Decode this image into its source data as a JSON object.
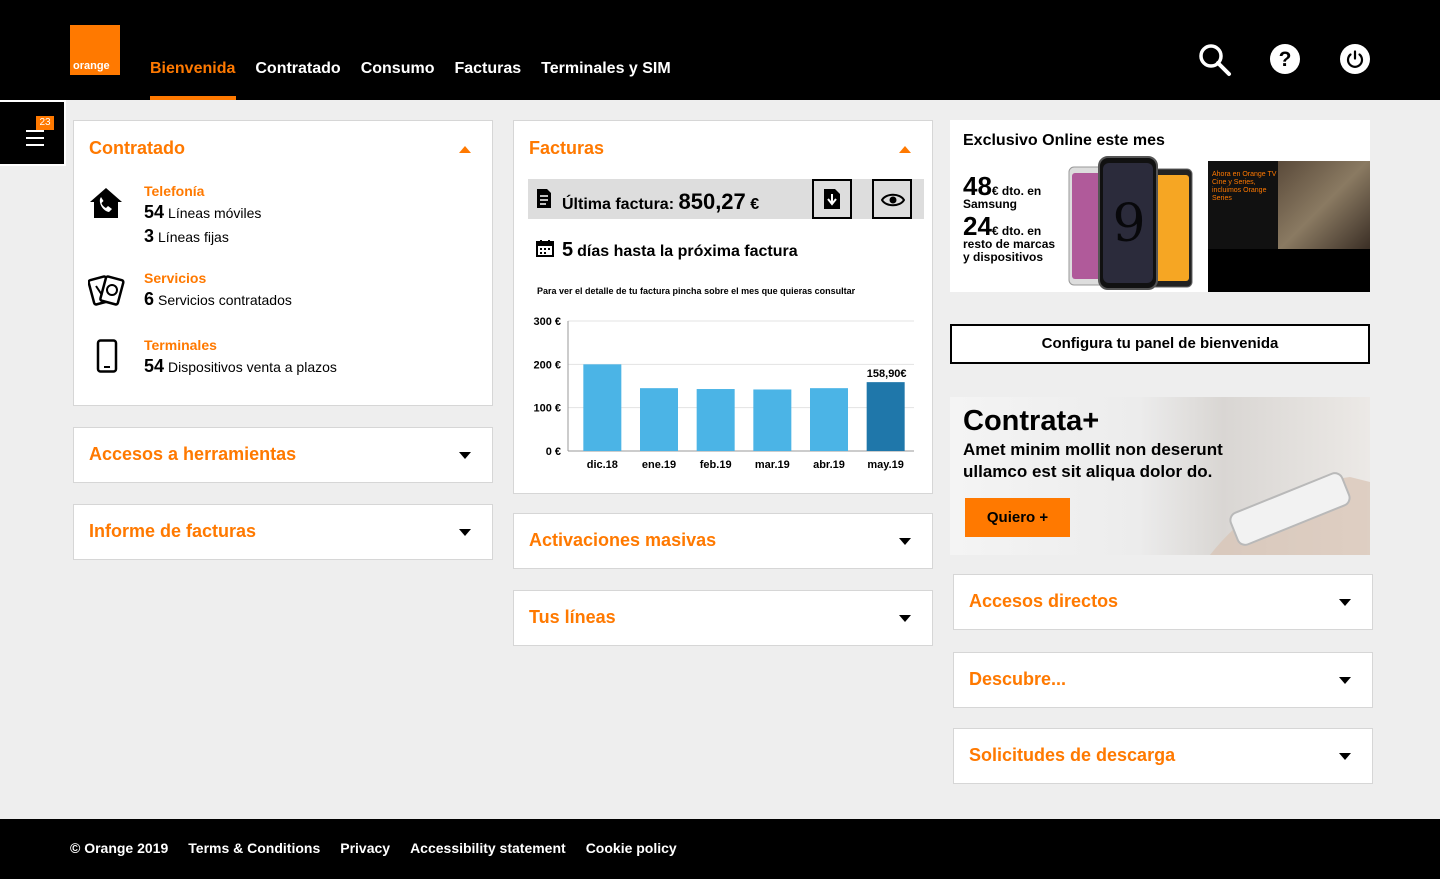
{
  "brand": {
    "logo_text": "orange",
    "accent": "#ff7900"
  },
  "nav": [
    {
      "label": "Bienvenida",
      "active": true
    },
    {
      "label": "Contratado"
    },
    {
      "label": "Consumo"
    },
    {
      "label": "Facturas"
    },
    {
      "label": "Terminales y SIM"
    }
  ],
  "header_icons": [
    "search-icon",
    "help-icon",
    "power-icon"
  ],
  "menu": {
    "badge": "23"
  },
  "contratado": {
    "title": "Contratado",
    "telefonia": {
      "label": "Telefonía",
      "moviles_count": "54",
      "moviles_label": "Líneas móviles",
      "fijas_count": "3",
      "fijas_label": "Líneas fijas"
    },
    "servicios": {
      "label": "Servicios",
      "count": "6",
      "text": "Servicios contratados"
    },
    "terminales": {
      "label": "Terminales",
      "count": "54",
      "text": "Dispositivos venta a plazos"
    }
  },
  "accesos_herramientas": {
    "title": "Accesos a herramientas"
  },
  "informe_facturas": {
    "title": "Informe de facturas"
  },
  "facturas": {
    "title": "Facturas",
    "last_label": "Última factura:",
    "last_amount": "850,27",
    "currency": "€",
    "days_count": "5",
    "days_text": "días hasta la próxima factura",
    "chart_note": "Para ver el detalle de tu factura pincha sobre el mes que quieras consultar"
  },
  "chart_data": {
    "type": "bar",
    "categories": [
      "dic.18",
      "ene.19",
      "feb.19",
      "mar.19",
      "abr.19",
      "may.19"
    ],
    "values": [
      200,
      145,
      143,
      142,
      145,
      158.9
    ],
    "yticks": [
      "0 €",
      "100 €",
      "200 €",
      "300 €"
    ],
    "ylim": [
      0,
      300
    ],
    "highlight_index": 5,
    "highlight_label": "158,90€",
    "colors": {
      "bar": "#4bb4e6",
      "highlight": "#1f77aa"
    }
  },
  "activaciones": {
    "title": "Activaciones masivas"
  },
  "tus_lineas": {
    "title": "Tus líneas"
  },
  "promo": {
    "title": "Exclusivo Online este mes",
    "offer1_num": "48",
    "offer1_unit": "€ dto. en",
    "offer1_brand": "Samsung",
    "offer2_num": "24",
    "offer2_unit": "€ dto. en",
    "offer2_text1": "resto de marcas",
    "offer2_text2": "y dispositivos",
    "tv_text": "Ahora en Orange TV Cine y Series, incluimos Orange Series"
  },
  "config_button": "Configura tu panel de bienvenida",
  "contrata": {
    "title": "Contrata+",
    "text": "Amet minim mollit non deserunt ullamco est sit aliqua dolor do.",
    "button": "Quiero +"
  },
  "accesos_directos": {
    "title": "Accesos directos"
  },
  "descubre": {
    "title": "Descubre..."
  },
  "solicitudes": {
    "title": "Solicitudes de descarga"
  },
  "footer": [
    "© Orange 2019",
    "Terms & Conditions",
    "Privacy",
    "Accessibility statement",
    "Cookie policy"
  ]
}
